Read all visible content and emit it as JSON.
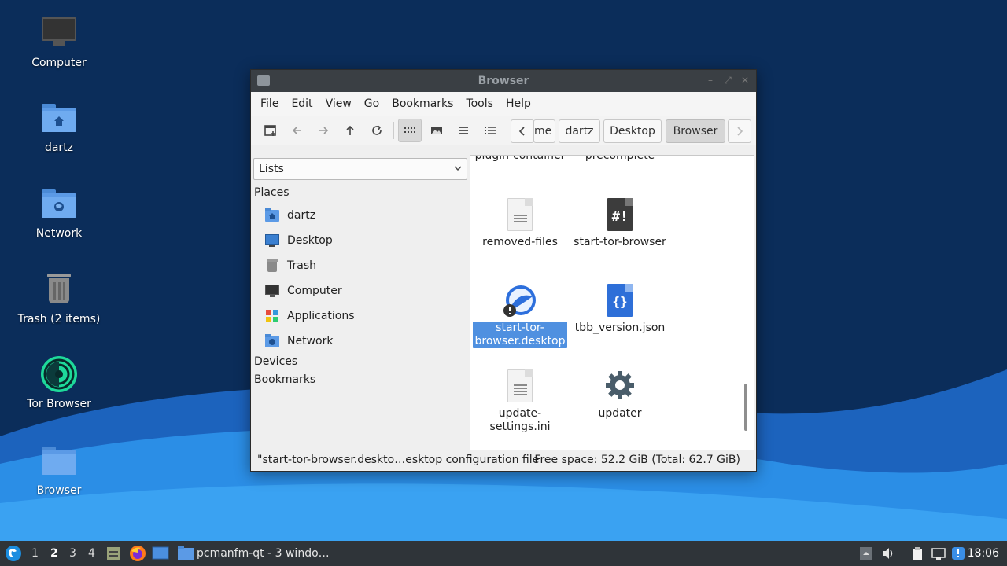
{
  "desktop": {
    "icons": [
      {
        "label": "Computer",
        "icon": "computer-icon"
      },
      {
        "label": "dartz",
        "icon": "home-folder-icon"
      },
      {
        "label": "Network",
        "icon": "network-folder-icon"
      },
      {
        "label": "Trash (2 items)",
        "icon": "trash-icon"
      },
      {
        "label": "Tor Browser",
        "icon": "tor-browser-icon"
      },
      {
        "label": "Browser",
        "icon": "folder-icon"
      }
    ]
  },
  "window": {
    "title": "Browser",
    "menu": [
      "File",
      "Edit",
      "View",
      "Go",
      "Bookmarks",
      "Tools",
      "Help"
    ],
    "breadcrumb": [
      "me",
      "dartz",
      "Desktop",
      "Browser"
    ],
    "side": {
      "selector": "Lists",
      "sections": {
        "places": "Places",
        "devices": "Devices",
        "bookmarks": "Bookmarks"
      },
      "places": [
        {
          "label": "dartz",
          "icon": "home-folder-icon"
        },
        {
          "label": "Desktop",
          "icon": "desktop-icon"
        },
        {
          "label": "Trash",
          "icon": "trash-icon"
        },
        {
          "label": "Computer",
          "icon": "computer-icon"
        },
        {
          "label": "Applications",
          "icon": "applications-icon"
        },
        {
          "label": "Network",
          "icon": "network-icon"
        }
      ]
    },
    "files": {
      "partial_top": [
        "plugin-container",
        "precomplete"
      ],
      "items": [
        {
          "name": "removed-files",
          "icon": "text-file-icon"
        },
        {
          "name": "start-tor-browser",
          "icon": "shell-script-icon"
        },
        {
          "name1": "start-tor-",
          "name2": "browser.desktop",
          "icon": "desktop-file-icon",
          "selected": true
        },
        {
          "name": "tbb_version.json",
          "icon": "json-file-icon"
        },
        {
          "name1": "update-",
          "name2": "settings.ini",
          "icon": "text-file-icon"
        },
        {
          "name": "updater",
          "icon": "gear-icon"
        }
      ]
    },
    "status": {
      "selection": "\"start-tor-browser.deskto…esktop configuration file",
      "free_space": "Free space: 52.2 GiB (Total: 62.7 GiB)"
    }
  },
  "taskbar": {
    "workspaces": [
      "1",
      "2",
      "3",
      "4"
    ],
    "active_workspace": "2",
    "task_label": "pcmanfm-qt - 3 windo…",
    "clock": "18:06"
  }
}
